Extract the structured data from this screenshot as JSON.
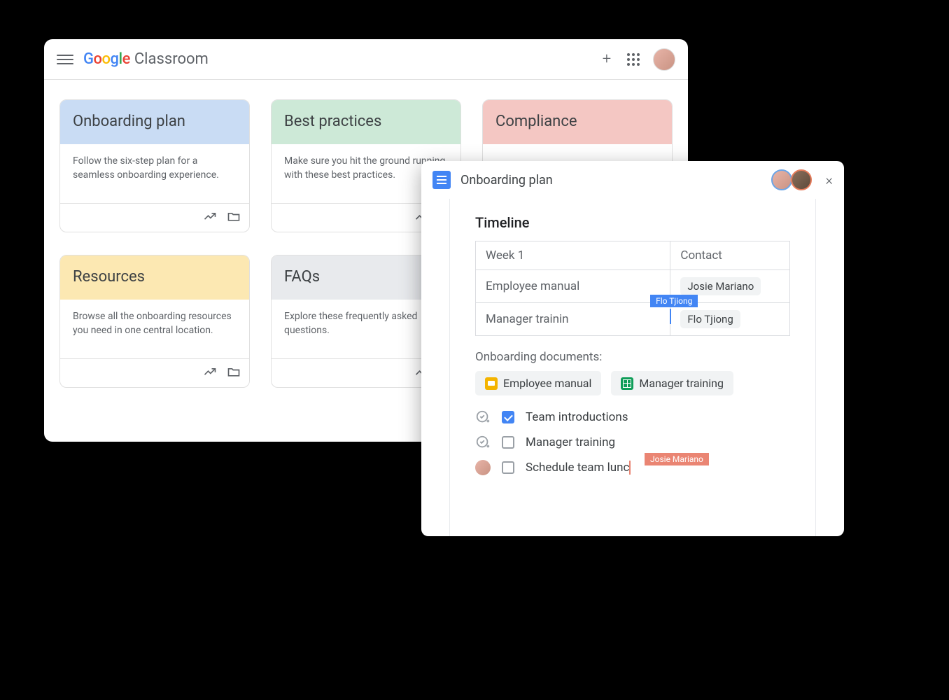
{
  "classroom": {
    "brand": "Google",
    "app_name": "Classroom",
    "cards": [
      {
        "title": "Onboarding plan",
        "desc": "Follow the six-step plan for a seamless onboarding experience.",
        "hclass": "blue-h"
      },
      {
        "title": "Best practices",
        "desc": "Make sure you hit the ground running with these best practices.",
        "hclass": "green-h"
      },
      {
        "title": "Compliance",
        "desc": "",
        "hclass": "red-h"
      },
      {
        "title": "Resources",
        "desc": "Browse all the onboarding resources you need in one central location.",
        "hclass": "yellow-h"
      },
      {
        "title": "FAQs",
        "desc": "Explore these frequently asked questions.",
        "hclass": "gray-h"
      }
    ]
  },
  "docs": {
    "title": "Onboarding plan",
    "section_title": "Timeline",
    "table": {
      "headers": [
        "Week 1",
        "Contact"
      ],
      "rows": [
        {
          "item": "Employee manual",
          "contact": "Josie Mariano"
        },
        {
          "item": "Manager trainin",
          "contact": "Flo Tjiong",
          "editing_flag": "Flo Tjiong"
        }
      ]
    },
    "subhead": "Onboarding documents:",
    "pills": [
      {
        "icon": "slides",
        "label": "Employee manual"
      },
      {
        "icon": "sheets",
        "label": "Manager training"
      }
    ],
    "tasks": [
      {
        "type": "addtask",
        "checked": true,
        "label": "Team introductions"
      },
      {
        "type": "addtask",
        "checked": false,
        "label": "Manager training"
      },
      {
        "type": "avatar",
        "checked": false,
        "label": "Schedule team lunc",
        "editing_flag": "Josie Mariano"
      }
    ]
  }
}
